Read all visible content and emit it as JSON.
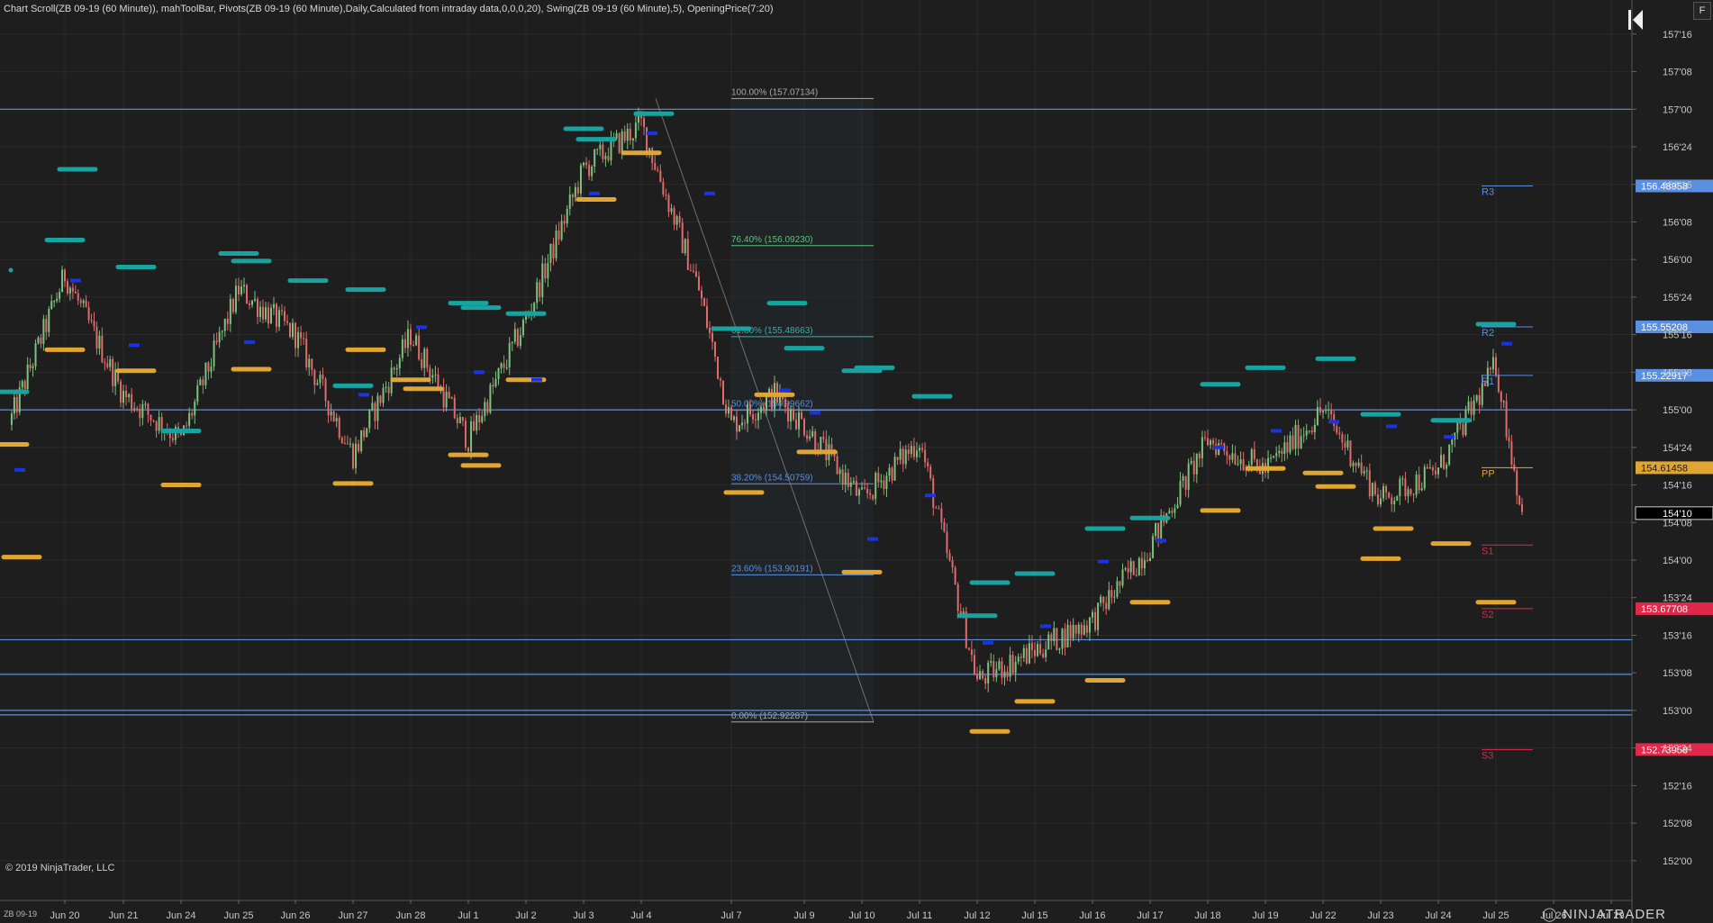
{
  "header_text": "Chart Scroll(ZB 09-19 (60 Minute)), mahToolBar, Pivots(ZB 09-19 (60 Minute),Daily,Calculated from intraday data,0,0,0,20), Swing(ZB 09-19 (60 Minute),5), OpeningPrice(7:20)",
  "copyright": "© 2019 NinjaTrader, LLC",
  "instrument": "ZB 09-19",
  "brand": "NINJATRADER",
  "f_button": "F",
  "colors": {
    "background": "#1e1e1e",
    "grid": "#2a2a2a",
    "up": "#7ec27e",
    "down": "#e06b6b",
    "swing_high": "#18a3a0",
    "swing_low": "#e0a631",
    "opening": "#1a35e0",
    "hline": "#5a8fe0",
    "pivot_r": "#5a8fe0",
    "pivot_pp": "#e0a631",
    "pivot_s": "#e0284a"
  },
  "chart_data": {
    "type": "candlestick",
    "title": "ZB 09-19 (60 Minute)",
    "ylim": [
      151.9,
      157.3
    ],
    "y_ticks": [
      "157'16",
      "157'08",
      "157'00",
      "156'24",
      "156'16",
      "156'08",
      "156'00",
      "155'24",
      "155'16",
      "155'08",
      "155'00",
      "154'24",
      "154'16",
      "154'08",
      "154'00",
      "153'24",
      "153'16",
      "153'08",
      "153'00",
      "152'24",
      "152'16",
      "152'08",
      "152'00"
    ],
    "y_tick_values": [
      157.5,
      157.25,
      157.0,
      156.75,
      156.5,
      156.25,
      156.0,
      155.75,
      155.5,
      155.25,
      155.0,
      154.75,
      154.5,
      154.25,
      154.0,
      153.75,
      153.5,
      153.25,
      153.0,
      152.75,
      152.5,
      152.25,
      152.0
    ],
    "dates": [
      "Jun 20",
      "Jun 21",
      "Jun 24",
      "Jun 25",
      "Jun 26",
      "Jun 27",
      "Jun 28",
      "Jul 1",
      "Jul 2",
      "Jul 3",
      "Jul 4",
      "Jul 7",
      "Jul 9",
      "Jul 10",
      "Jul 11",
      "Jul 12",
      "Jul 15",
      "Jul 16",
      "Jul 17",
      "Jul 18",
      "Jul 19",
      "Jul 22",
      "Jul 23",
      "Jul 24",
      "Jul 25",
      "Jul 26",
      "Jul 29"
    ],
    "daily_path": [
      {
        "date": "Jun 19",
        "price": 154.9
      },
      {
        "date": "Jun 20",
        "price": 155.9
      },
      {
        "date": "Jun 21",
        "price": 155.1
      },
      {
        "date": "Jun 24",
        "price": 154.8
      },
      {
        "date": "Jun 25",
        "price": 155.8
      },
      {
        "date": "Jun 26",
        "price": 155.5
      },
      {
        "date": "Jun 27",
        "price": 154.7
      },
      {
        "date": "Jun 28",
        "price": 155.5
      },
      {
        "date": "Jul 1",
        "price": 154.8
      },
      {
        "date": "Jul 2",
        "price": 155.6
      },
      {
        "date": "Jul 3",
        "price": 156.6
      },
      {
        "date": "Jul 4",
        "price": 156.9
      },
      {
        "date": "Jul 5",
        "price": 155.8
      },
      {
        "date": "Jul 7",
        "price": 154.9
      },
      {
        "date": "Jul 8",
        "price": 155.1
      },
      {
        "date": "Jul 9",
        "price": 154.9
      },
      {
        "date": "Jul 10",
        "price": 154.4
      },
      {
        "date": "Jul 11",
        "price": 154.8
      },
      {
        "date": "Jul 12",
        "price": 153.2
      },
      {
        "date": "Jul 15",
        "price": 153.4
      },
      {
        "date": "Jul 16",
        "price": 153.6
      },
      {
        "date": "Jul 17",
        "price": 154.1
      },
      {
        "date": "Jul 18",
        "price": 154.8
      },
      {
        "date": "Jul 19",
        "price": 154.6
      },
      {
        "date": "Jul 22",
        "price": 155.0
      },
      {
        "date": "Jul 23",
        "price": 154.4
      },
      {
        "date": "Jul 24",
        "price": 154.6
      },
      {
        "date": "Jul 25",
        "price": 155.3
      },
      {
        "date": "Jul 25 close",
        "price": 154.3
      }
    ],
    "swing_highs": [
      {
        "date": "Jun 19",
        "price": 155.12
      },
      {
        "date": "Jun 20",
        "price": 156.6
      },
      {
        "date": "Jun 20",
        "price": 156.13
      },
      {
        "date": "Jun 21",
        "price": 155.95
      },
      {
        "date": "Jun 24",
        "price": 154.86
      },
      {
        "date": "Jun 25",
        "price": 155.99
      },
      {
        "date": "Jun 25",
        "price": 156.04
      },
      {
        "date": "Jun 26",
        "price": 155.86
      },
      {
        "date": "Jun 27",
        "price": 155.16
      },
      {
        "date": "Jun 27",
        "price": 155.8
      },
      {
        "date": "Jul 1",
        "price": 155.71
      },
      {
        "date": "Jul 1",
        "price": 155.68
      },
      {
        "date": "Jul 2",
        "price": 155.64
      },
      {
        "date": "Jul 3",
        "price": 156.8
      },
      {
        "date": "Jul 3",
        "price": 156.87
      },
      {
        "date": "Jul 4",
        "price": 156.97
      },
      {
        "date": "Jul 7",
        "price": 155.54
      },
      {
        "date": "Jul 8",
        "price": 155.71
      },
      {
        "date": "Jul 9",
        "price": 155.41
      },
      {
        "date": "Jul 10",
        "price": 155.28
      },
      {
        "date": "Jul 10",
        "price": 155.26
      },
      {
        "date": "Jul 11",
        "price": 155.09
      },
      {
        "date": "Jul 12",
        "price": 153.63
      },
      {
        "date": "Jul 12",
        "price": 153.85
      },
      {
        "date": "Jul 15",
        "price": 153.91
      },
      {
        "date": "Jul 16",
        "price": 154.21
      },
      {
        "date": "Jul 17",
        "price": 154.28
      },
      {
        "date": "Jul 18",
        "price": 155.17
      },
      {
        "date": "Jul 19",
        "price": 155.28
      },
      {
        "date": "Jul 22",
        "price": 155.34
      },
      {
        "date": "Jul 23",
        "price": 154.97
      },
      {
        "date": "Jul 24",
        "price": 154.93
      },
      {
        "date": "Jul 25",
        "price": 155.57
      }
    ],
    "swing_lows": [
      {
        "date": "Jun 19",
        "price": 154.77
      },
      {
        "date": "Jun 19",
        "price": 154.02
      },
      {
        "date": "Jun 20",
        "price": 155.4
      },
      {
        "date": "Jun 21",
        "price": 155.26
      },
      {
        "date": "Jun 24",
        "price": 154.5
      },
      {
        "date": "Jun 25",
        "price": 155.27
      },
      {
        "date": "Jun 27",
        "price": 154.51
      },
      {
        "date": "Jun 27",
        "price": 155.4
      },
      {
        "date": "Jun 28",
        "price": 155.2
      },
      {
        "date": "Jun 28",
        "price": 155.14
      },
      {
        "date": "Jul 1",
        "price": 154.7
      },
      {
        "date": "Jul 1",
        "price": 154.63
      },
      {
        "date": "Jul 2",
        "price": 155.2
      },
      {
        "date": "Jul 3",
        "price": 156.4
      },
      {
        "date": "Jul 4",
        "price": 156.71
      },
      {
        "date": "Jul 7",
        "price": 154.45
      },
      {
        "date": "Jul 8",
        "price": 155.1
      },
      {
        "date": "Jul 9",
        "price": 154.72
      },
      {
        "date": "Jul 10",
        "price": 153.92
      },
      {
        "date": "Jul 12",
        "price": 152.86
      },
      {
        "date": "Jul 15",
        "price": 153.06
      },
      {
        "date": "Jul 16",
        "price": 153.2
      },
      {
        "date": "Jul 17",
        "price": 153.72
      },
      {
        "date": "Jul 18",
        "price": 154.33
      },
      {
        "date": "Jul 19",
        "price": 154.61
      },
      {
        "date": "Jul 22",
        "price": 154.49
      },
      {
        "date": "Jul 22",
        "price": 154.58
      },
      {
        "date": "Jul 23",
        "price": 154.21
      },
      {
        "date": "Jul 23",
        "price": 154.01
      },
      {
        "date": "Jul 24",
        "price": 154.11
      },
      {
        "date": "Jul 25",
        "price": 153.72
      }
    ],
    "opening_prices": [
      {
        "date": "Jun 19",
        "price": 154.6
      },
      {
        "date": "Jun 20",
        "price": 155.86
      },
      {
        "date": "Jun 21",
        "price": 155.43
      },
      {
        "date": "Jun 25",
        "price": 155.45
      },
      {
        "date": "Jun 27",
        "price": 155.1
      },
      {
        "date": "Jun 28",
        "price": 155.55
      },
      {
        "date": "Jul 1",
        "price": 155.25
      },
      {
        "date": "Jul 2",
        "price": 155.2
      },
      {
        "date": "Jul 3",
        "price": 156.44
      },
      {
        "date": "Jul 4",
        "price": 156.84
      },
      {
        "date": "Jul 5",
        "price": 156.44
      },
      {
        "date": "Jul 8",
        "price": 155.13
      },
      {
        "date": "Jul 9",
        "price": 154.98
      },
      {
        "date": "Jul 10",
        "price": 154.14
      },
      {
        "date": "Jul 11",
        "price": 154.43
      },
      {
        "date": "Jul 12",
        "price": 153.45
      },
      {
        "date": "Jul 15",
        "price": 153.56
      },
      {
        "date": "Jul 16",
        "price": 153.99
      },
      {
        "date": "Jul 17",
        "price": 154.13
      },
      {
        "date": "Jul 18",
        "price": 154.75
      },
      {
        "date": "Jul 19",
        "price": 154.86
      },
      {
        "date": "Jul 22",
        "price": 154.92
      },
      {
        "date": "Jul 23",
        "price": 154.89
      },
      {
        "date": "Jul 24",
        "price": 154.82
      },
      {
        "date": "Jul 25",
        "price": 155.44
      }
    ],
    "horizontal_lines": [
      157.0,
      155.0,
      153.47,
      153.24,
      153.0,
      152.97
    ],
    "fibonacci": {
      "from_date": "Jul 4",
      "to_date": "Jul 10",
      "levels": [
        {
          "label": "100.00% (157.07134)",
          "price": 157.07134
        },
        {
          "label": "76.40% (156.09230)",
          "price": 156.0923
        },
        {
          "label": "61.80% (155.48663)",
          "price": 155.48663
        },
        {
          "label": "50.00% (154.99662)",
          "price": 154.99662
        },
        {
          "label": "38.20% (154.50759)",
          "price": 154.50759
        },
        {
          "label": "23.60% (153.90191)",
          "price": 153.90191
        },
        {
          "label": "0.00% (152.92287)",
          "price": 152.92287
        }
      ]
    },
    "pivots": [
      {
        "name": "R3",
        "price": 156.48958,
        "tag": "156.48958"
      },
      {
        "name": "R2",
        "price": 155.55208,
        "tag": "155.55208"
      },
      {
        "name": "R1",
        "price": 155.22917,
        "tag": "155.22917"
      },
      {
        "name": "PP",
        "price": 154.61458,
        "tag": "154.61458"
      },
      {
        "name": "S1",
        "price": 154.1,
        "tag": ""
      },
      {
        "name": "S2",
        "price": 153.67708,
        "tag": "153.67708"
      },
      {
        "name": "S3",
        "price": 152.73958,
        "tag": "152.73958"
      }
    ],
    "last_price": {
      "price": 154.3125,
      "label": "154'10"
    }
  }
}
